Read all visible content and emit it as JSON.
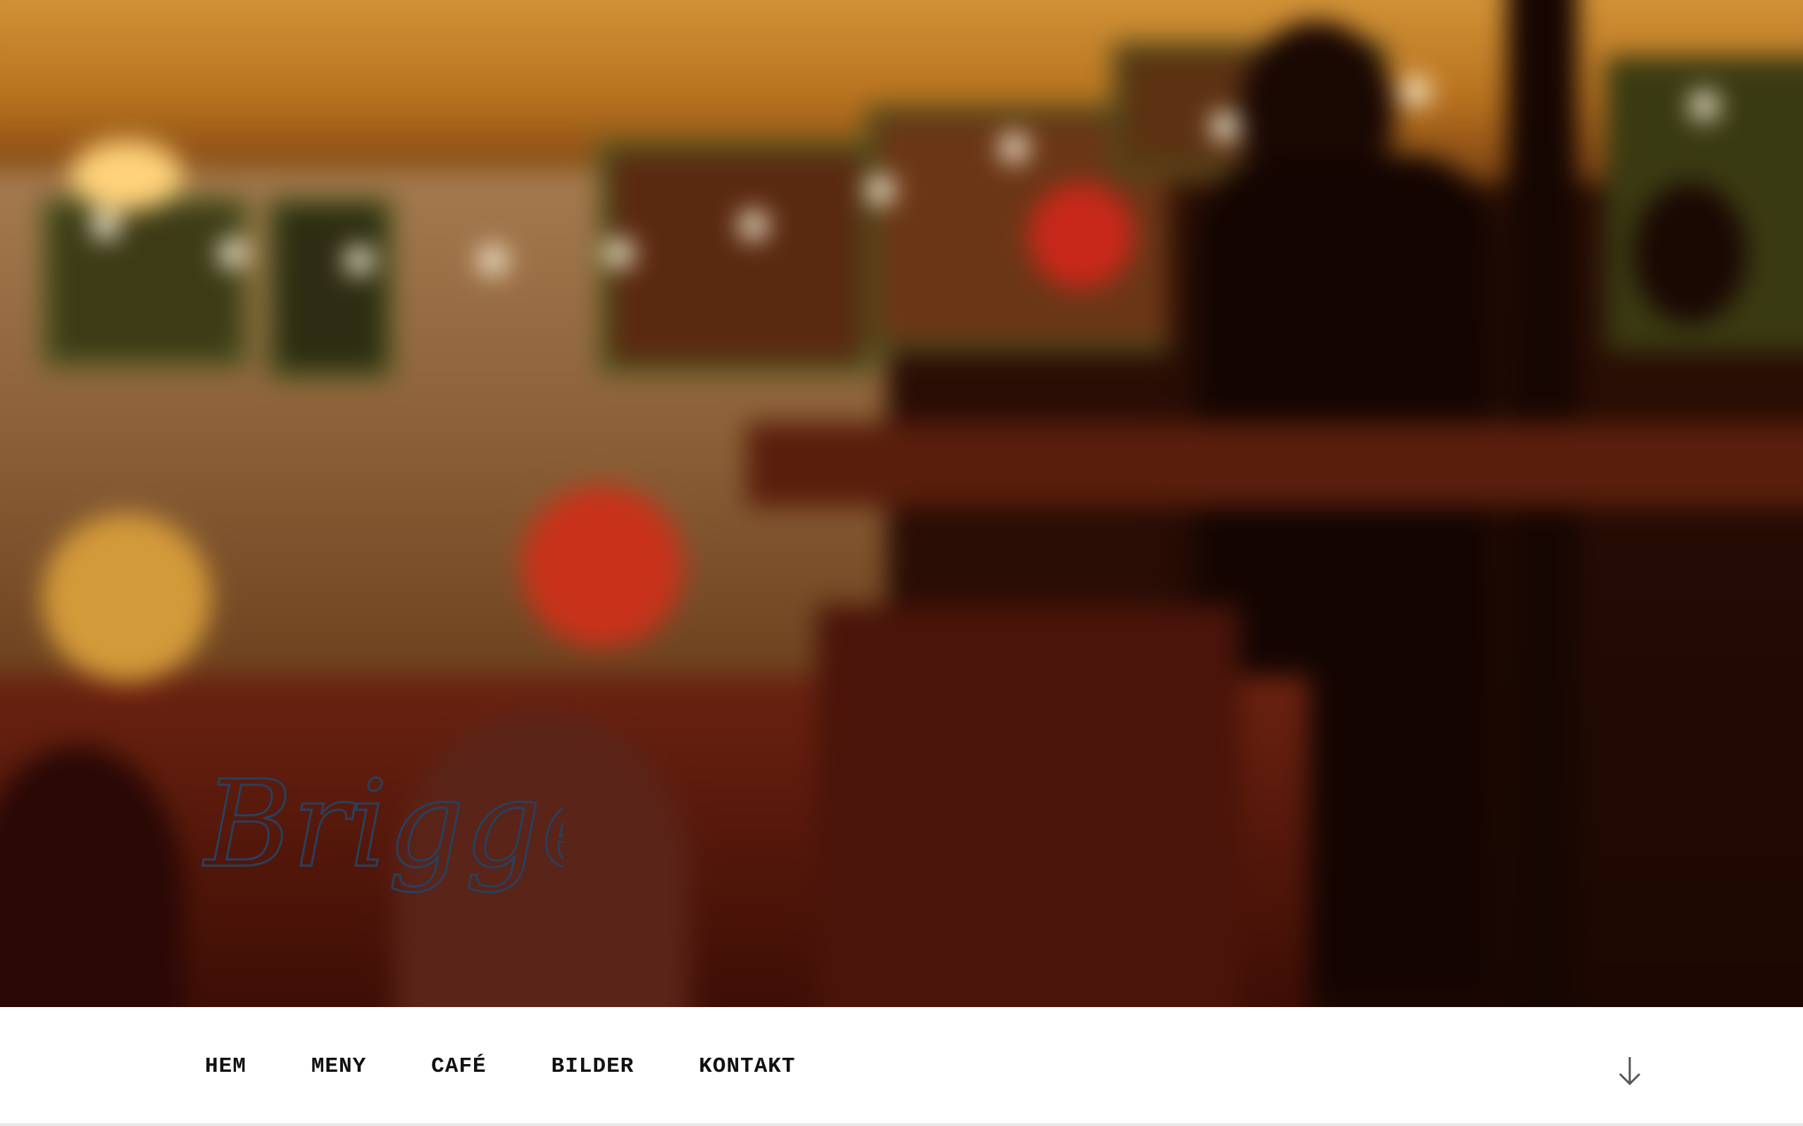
{
  "hero": {
    "background": "blurred night-time café interior with string lights and paper lanterns",
    "logo_text": "Briggen",
    "logo_color": "#27415f"
  },
  "nav": {
    "items": [
      {
        "label": "HEM"
      },
      {
        "label": "MENY"
      },
      {
        "label": "CAFÉ"
      },
      {
        "label": "BILDER"
      },
      {
        "label": "KONTAKT"
      }
    ],
    "scroll_icon": "arrow-down-icon"
  }
}
